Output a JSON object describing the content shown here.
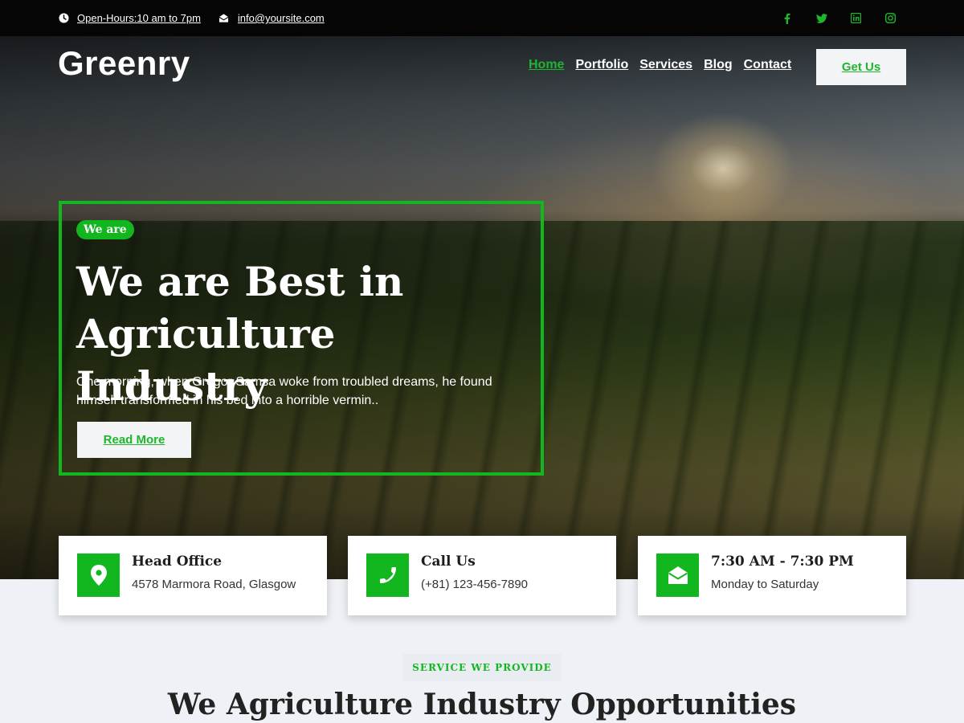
{
  "topbar": {
    "hours": "Open-Hours:10 am to 7pm",
    "email": "info@yoursite.com",
    "social_icons": [
      "facebook-icon",
      "twitter-icon",
      "linkedin-icon",
      "instagram-icon"
    ]
  },
  "brand": {
    "logo": "Greenry"
  },
  "nav": {
    "items": [
      {
        "label": "Home",
        "active": true
      },
      {
        "label": "Portfolio",
        "active": false
      },
      {
        "label": "Services",
        "active": false
      },
      {
        "label": "Blog",
        "active": false
      },
      {
        "label": "Contact",
        "active": false
      }
    ],
    "cta": "Get Us"
  },
  "hero": {
    "pill": "We are",
    "title": "We are Best in Agriculture Industry",
    "text": "One morning, when Gregor Samsa woke from troubled dreams, he found himself transformed in his bed into a horrible vermin..",
    "button": "Read More"
  },
  "cards": [
    {
      "icon": "location-pin-icon",
      "title": "Head Office",
      "sub": "4578 Marmora Road, Glasgow"
    },
    {
      "icon": "phone-icon",
      "title": "Call Us",
      "sub": "(+81) 123-456-7890"
    },
    {
      "icon": "envelope-open-icon",
      "title": "7:30 AM - 7:30 PM",
      "sub": "Monday to Saturday"
    }
  ],
  "services": {
    "tag": "SERVICE WE PROVIDE",
    "title": "We Agriculture Industry Opportunities"
  },
  "colors": {
    "accent": "#12b71f",
    "topbar": "#050505",
    "background": "#eef1f5"
  }
}
